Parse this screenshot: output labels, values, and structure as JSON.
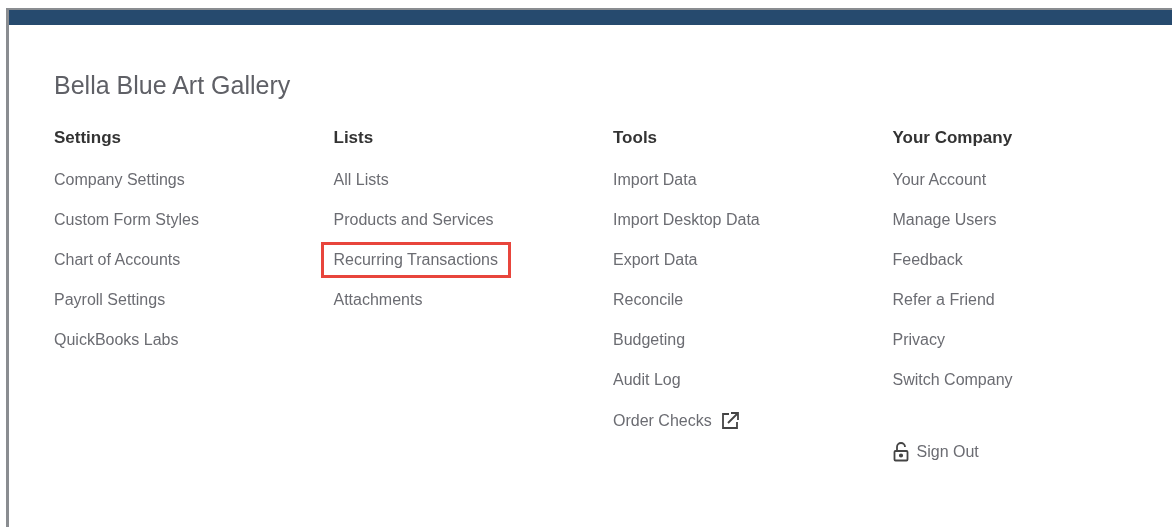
{
  "company_name": "Bella Blue Art Gallery",
  "columns": [
    {
      "heading": "Settings",
      "items": [
        {
          "label": "Company Settings",
          "kind": "link",
          "highlighted": false
        },
        {
          "label": "Custom Form Styles",
          "kind": "link",
          "highlighted": false
        },
        {
          "label": "Chart of Accounts",
          "kind": "link",
          "highlighted": false
        },
        {
          "label": "Payroll Settings",
          "kind": "link",
          "highlighted": false
        },
        {
          "label": "QuickBooks Labs",
          "kind": "link",
          "highlighted": false
        }
      ]
    },
    {
      "heading": "Lists",
      "items": [
        {
          "label": "All Lists",
          "kind": "link",
          "highlighted": false
        },
        {
          "label": "Products and Services",
          "kind": "link",
          "highlighted": false
        },
        {
          "label": "Recurring Transactions",
          "kind": "link",
          "highlighted": true
        },
        {
          "label": "Attachments",
          "kind": "link",
          "highlighted": false
        }
      ]
    },
    {
      "heading": "Tools",
      "items": [
        {
          "label": "Import Data",
          "kind": "link",
          "highlighted": false
        },
        {
          "label": "Import Desktop Data",
          "kind": "link",
          "highlighted": false
        },
        {
          "label": "Export Data",
          "kind": "link",
          "highlighted": false
        },
        {
          "label": "Reconcile",
          "kind": "link",
          "highlighted": false
        },
        {
          "label": "Budgeting",
          "kind": "link",
          "highlighted": false
        },
        {
          "label": "Audit Log",
          "kind": "link",
          "highlighted": false
        },
        {
          "label": "Order Checks",
          "kind": "external",
          "highlighted": false
        }
      ]
    },
    {
      "heading": "Your Company",
      "items": [
        {
          "label": "Your Account",
          "kind": "link",
          "highlighted": false
        },
        {
          "label": "Manage Users",
          "kind": "link",
          "highlighted": false
        },
        {
          "label": "Feedback",
          "kind": "link",
          "highlighted": false
        },
        {
          "label": "Refer a Friend",
          "kind": "link",
          "highlighted": false
        },
        {
          "label": "Privacy",
          "kind": "link",
          "highlighted": false
        },
        {
          "label": "Switch Company",
          "kind": "link",
          "highlighted": false
        },
        {
          "label": "Sign Out",
          "kind": "signout",
          "highlighted": false
        }
      ]
    }
  ]
}
